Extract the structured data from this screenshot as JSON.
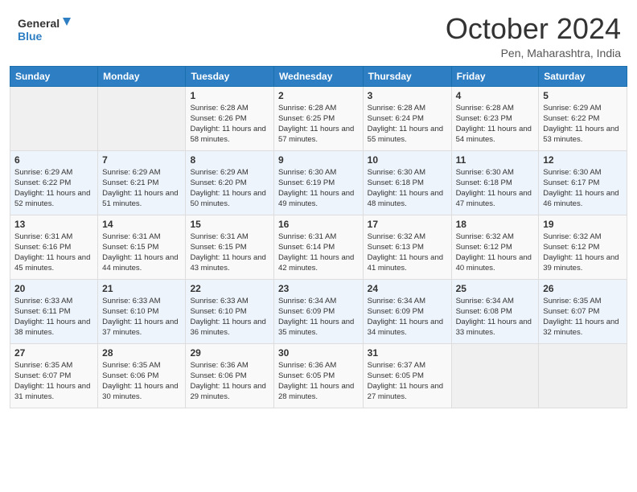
{
  "header": {
    "logo_line1": "General",
    "logo_line2": "Blue",
    "month": "October 2024",
    "location": "Pen, Maharashtra, India"
  },
  "weekdays": [
    "Sunday",
    "Monday",
    "Tuesday",
    "Wednesday",
    "Thursday",
    "Friday",
    "Saturday"
  ],
  "weeks": [
    [
      {
        "day": "",
        "empty": true
      },
      {
        "day": "",
        "empty": true
      },
      {
        "day": "1",
        "sunrise": "6:28 AM",
        "sunset": "6:26 PM",
        "daylight": "11 hours and 58 minutes."
      },
      {
        "day": "2",
        "sunrise": "6:28 AM",
        "sunset": "6:25 PM",
        "daylight": "11 hours and 57 minutes."
      },
      {
        "day": "3",
        "sunrise": "6:28 AM",
        "sunset": "6:24 PM",
        "daylight": "11 hours and 55 minutes."
      },
      {
        "day": "4",
        "sunrise": "6:28 AM",
        "sunset": "6:23 PM",
        "daylight": "11 hours and 54 minutes."
      },
      {
        "day": "5",
        "sunrise": "6:29 AM",
        "sunset": "6:22 PM",
        "daylight": "11 hours and 53 minutes."
      }
    ],
    [
      {
        "day": "6",
        "sunrise": "6:29 AM",
        "sunset": "6:22 PM",
        "daylight": "11 hours and 52 minutes."
      },
      {
        "day": "7",
        "sunrise": "6:29 AM",
        "sunset": "6:21 PM",
        "daylight": "11 hours and 51 minutes."
      },
      {
        "day": "8",
        "sunrise": "6:29 AM",
        "sunset": "6:20 PM",
        "daylight": "11 hours and 50 minutes."
      },
      {
        "day": "9",
        "sunrise": "6:30 AM",
        "sunset": "6:19 PM",
        "daylight": "11 hours and 49 minutes."
      },
      {
        "day": "10",
        "sunrise": "6:30 AM",
        "sunset": "6:18 PM",
        "daylight": "11 hours and 48 minutes."
      },
      {
        "day": "11",
        "sunrise": "6:30 AM",
        "sunset": "6:18 PM",
        "daylight": "11 hours and 47 minutes."
      },
      {
        "day": "12",
        "sunrise": "6:30 AM",
        "sunset": "6:17 PM",
        "daylight": "11 hours and 46 minutes."
      }
    ],
    [
      {
        "day": "13",
        "sunrise": "6:31 AM",
        "sunset": "6:16 PM",
        "daylight": "11 hours and 45 minutes."
      },
      {
        "day": "14",
        "sunrise": "6:31 AM",
        "sunset": "6:15 PM",
        "daylight": "11 hours and 44 minutes."
      },
      {
        "day": "15",
        "sunrise": "6:31 AM",
        "sunset": "6:15 PM",
        "daylight": "11 hours and 43 minutes."
      },
      {
        "day": "16",
        "sunrise": "6:31 AM",
        "sunset": "6:14 PM",
        "daylight": "11 hours and 42 minutes."
      },
      {
        "day": "17",
        "sunrise": "6:32 AM",
        "sunset": "6:13 PM",
        "daylight": "11 hours and 41 minutes."
      },
      {
        "day": "18",
        "sunrise": "6:32 AM",
        "sunset": "6:12 PM",
        "daylight": "11 hours and 40 minutes."
      },
      {
        "day": "19",
        "sunrise": "6:32 AM",
        "sunset": "6:12 PM",
        "daylight": "11 hours and 39 minutes."
      }
    ],
    [
      {
        "day": "20",
        "sunrise": "6:33 AM",
        "sunset": "6:11 PM",
        "daylight": "11 hours and 38 minutes."
      },
      {
        "day": "21",
        "sunrise": "6:33 AM",
        "sunset": "6:10 PM",
        "daylight": "11 hours and 37 minutes."
      },
      {
        "day": "22",
        "sunrise": "6:33 AM",
        "sunset": "6:10 PM",
        "daylight": "11 hours and 36 minutes."
      },
      {
        "day": "23",
        "sunrise": "6:34 AM",
        "sunset": "6:09 PM",
        "daylight": "11 hours and 35 minutes."
      },
      {
        "day": "24",
        "sunrise": "6:34 AM",
        "sunset": "6:09 PM",
        "daylight": "11 hours and 34 minutes."
      },
      {
        "day": "25",
        "sunrise": "6:34 AM",
        "sunset": "6:08 PM",
        "daylight": "11 hours and 33 minutes."
      },
      {
        "day": "26",
        "sunrise": "6:35 AM",
        "sunset": "6:07 PM",
        "daylight": "11 hours and 32 minutes."
      }
    ],
    [
      {
        "day": "27",
        "sunrise": "6:35 AM",
        "sunset": "6:07 PM",
        "daylight": "11 hours and 31 minutes."
      },
      {
        "day": "28",
        "sunrise": "6:35 AM",
        "sunset": "6:06 PM",
        "daylight": "11 hours and 30 minutes."
      },
      {
        "day": "29",
        "sunrise": "6:36 AM",
        "sunset": "6:06 PM",
        "daylight": "11 hours and 29 minutes."
      },
      {
        "day": "30",
        "sunrise": "6:36 AM",
        "sunset": "6:05 PM",
        "daylight": "11 hours and 28 minutes."
      },
      {
        "day": "31",
        "sunrise": "6:37 AM",
        "sunset": "6:05 PM",
        "daylight": "11 hours and 27 minutes."
      },
      {
        "day": "",
        "empty": true
      },
      {
        "day": "",
        "empty": true
      }
    ]
  ]
}
